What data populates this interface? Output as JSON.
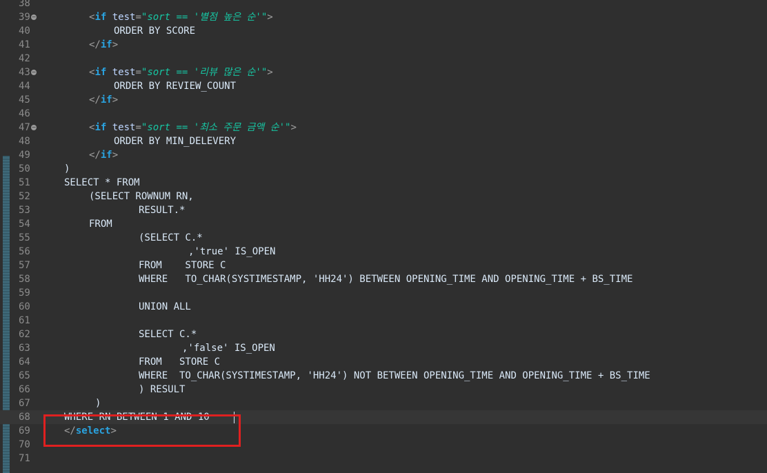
{
  "editor": {
    "lines": [
      {
        "n": "38",
        "indent": 0,
        "tokens": []
      },
      {
        "n": "39",
        "fold": true,
        "indent": 72,
        "tokens": [
          {
            "t": "<",
            "c": "tag"
          },
          {
            "t": "if",
            "c": "kw"
          },
          {
            "t": " ",
            "c": "sql"
          },
          {
            "t": "test",
            "c": "attr"
          },
          {
            "t": "=",
            "c": "tag"
          },
          {
            "t": "\"sort == '별점 높은 순'\"",
            "c": "str"
          },
          {
            "t": ">",
            "c": "tag"
          }
        ]
      },
      {
        "n": "40",
        "indent": 108,
        "tokens": [
          {
            "t": "ORDER BY SCORE",
            "c": "sql"
          }
        ]
      },
      {
        "n": "41",
        "indent": 72,
        "tokens": [
          {
            "t": "</",
            "c": "tag"
          },
          {
            "t": "if",
            "c": "kw"
          },
          {
            "t": ">",
            "c": "tag"
          }
        ]
      },
      {
        "n": "42",
        "indent": 0,
        "tokens": []
      },
      {
        "n": "43",
        "fold": true,
        "indent": 72,
        "tokens": [
          {
            "t": "<",
            "c": "tag"
          },
          {
            "t": "if",
            "c": "kw"
          },
          {
            "t": " ",
            "c": "sql"
          },
          {
            "t": "test",
            "c": "attr"
          },
          {
            "t": "=",
            "c": "tag"
          },
          {
            "t": "\"sort == '리뷰 많은 순'\"",
            "c": "str"
          },
          {
            "t": ">",
            "c": "tag"
          }
        ]
      },
      {
        "n": "44",
        "indent": 108,
        "tokens": [
          {
            "t": "ORDER BY REVIEW_COUNT",
            "c": "sql"
          }
        ]
      },
      {
        "n": "45",
        "indent": 72,
        "tokens": [
          {
            "t": "</",
            "c": "tag"
          },
          {
            "t": "if",
            "c": "kw"
          },
          {
            "t": ">",
            "c": "tag"
          }
        ]
      },
      {
        "n": "46",
        "indent": 0,
        "tokens": []
      },
      {
        "n": "47",
        "fold": true,
        "indent": 72,
        "tokens": [
          {
            "t": "<",
            "c": "tag"
          },
          {
            "t": "if",
            "c": "kw"
          },
          {
            "t": " ",
            "c": "sql"
          },
          {
            "t": "test",
            "c": "attr"
          },
          {
            "t": "=",
            "c": "tag"
          },
          {
            "t": "\"sort == '최소 주문 금액 순'\"",
            "c": "str"
          },
          {
            "t": ">",
            "c": "tag"
          }
        ]
      },
      {
        "n": "48",
        "indent": 108,
        "tokens": [
          {
            "t": "ORDER BY MIN_DELEVERY",
            "c": "sql"
          }
        ]
      },
      {
        "n": "49",
        "indent": 72,
        "tokens": [
          {
            "t": "</",
            "c": "tag"
          },
          {
            "t": "if",
            "c": "kw"
          },
          {
            "t": ">",
            "c": "tag"
          }
        ]
      },
      {
        "n": "50",
        "indent": 36,
        "tokens": [
          {
            "t": ")",
            "c": "sql"
          }
        ]
      },
      {
        "n": "51",
        "indent": 36,
        "tokens": [
          {
            "t": "SELECT * FROM",
            "c": "sql"
          }
        ]
      },
      {
        "n": "52",
        "indent": 72,
        "tokens": [
          {
            "t": "(SELECT ROWNUM RN,",
            "c": "sql"
          }
        ]
      },
      {
        "n": "53",
        "indent": 144,
        "tokens": [
          {
            "t": "RESULT.*",
            "c": "sql"
          }
        ]
      },
      {
        "n": "54",
        "indent": 72,
        "tokens": [
          {
            "t": "FROM",
            "c": "sql"
          }
        ]
      },
      {
        "n": "55",
        "indent": 144,
        "tokens": [
          {
            "t": "(SELECT C.*",
            "c": "sql"
          }
        ]
      },
      {
        "n": "56",
        "indent": 216,
        "tokens": [
          {
            "t": ",'true' IS_OPEN",
            "c": "sql"
          }
        ]
      },
      {
        "n": "57",
        "indent": 144,
        "tokens": [
          {
            "t": "FROM    STORE C",
            "c": "sql"
          }
        ]
      },
      {
        "n": "58",
        "indent": 144,
        "tokens": [
          {
            "t": "WHERE   TO_CHAR(SYSTIMESTAMP, 'HH24') BETWEEN OPENING_TIME AND OPENING_TIME + BS_TIME",
            "c": "sql"
          }
        ]
      },
      {
        "n": "59",
        "indent": 0,
        "tokens": []
      },
      {
        "n": "60",
        "indent": 144,
        "tokens": [
          {
            "t": "UNION ALL",
            "c": "sql"
          }
        ]
      },
      {
        "n": "61",
        "indent": 0,
        "tokens": []
      },
      {
        "n": "62",
        "indent": 144,
        "tokens": [
          {
            "t": "SELECT C.*",
            "c": "sql"
          }
        ]
      },
      {
        "n": "63",
        "indent": 207,
        "tokens": [
          {
            "t": ",'false' IS_OPEN",
            "c": "sql"
          }
        ]
      },
      {
        "n": "64",
        "indent": 144,
        "tokens": [
          {
            "t": "FROM   STORE C",
            "c": "sql"
          }
        ]
      },
      {
        "n": "65",
        "indent": 144,
        "tokens": [
          {
            "t": "WHERE  TO_CHAR(SYSTIMESTAMP, 'HH24') NOT BETWEEN OPENING_TIME AND OPENING_TIME + BS_TIME",
            "c": "sql"
          }
        ]
      },
      {
        "n": "66",
        "indent": 144,
        "tokens": [
          {
            "t": ") RESULT",
            "c": "sql"
          }
        ]
      },
      {
        "n": "67",
        "indent": 81,
        "tokens": [
          {
            "t": ")",
            "c": "sql"
          }
        ]
      },
      {
        "n": "68",
        "indent": 36,
        "current": true,
        "tokens": [
          {
            "t": "WHERE RN BETWEEN 1 AND 10",
            "c": "sql"
          }
        ]
      },
      {
        "n": "69",
        "indent": 36,
        "tokens": [
          {
            "t": "</",
            "c": "tag"
          },
          {
            "t": "select",
            "c": "kw"
          },
          {
            "t": ">",
            "c": "tag"
          }
        ]
      },
      {
        "n": "70",
        "indent": 0,
        "tokens": []
      },
      {
        "n": "71",
        "indent": 0,
        "tokens": []
      }
    ]
  },
  "colors": {
    "background": "#2f2f2f",
    "keyword": "#2aa3e0",
    "string": "#17c6a3",
    "highlight_box": "#e02020"
  }
}
